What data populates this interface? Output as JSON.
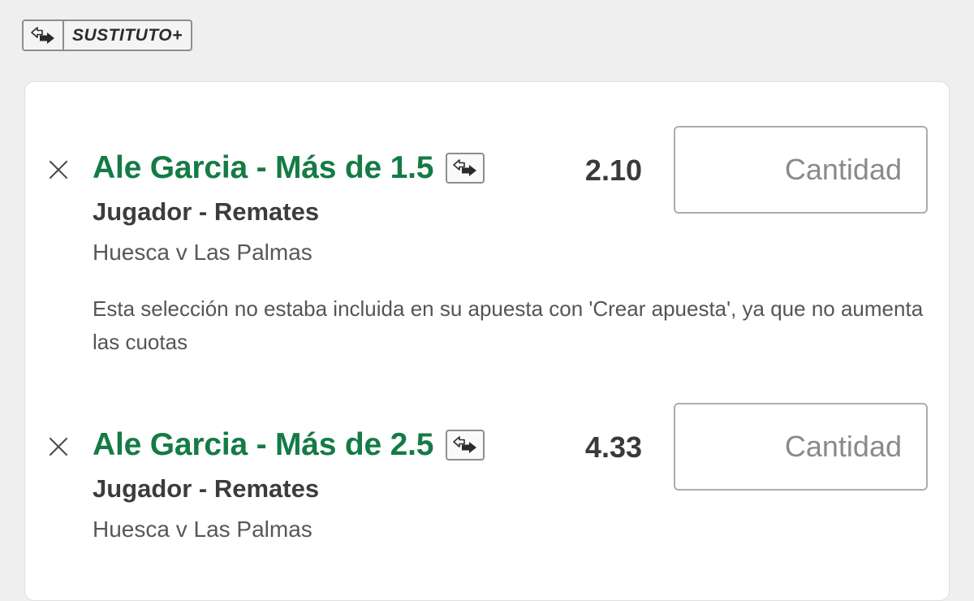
{
  "header": {
    "badge_label": "SUSTITUTO+",
    "badge_icon": "swap-arrows-icon"
  },
  "selections": [
    {
      "title": "Ale Garcia - Más de 1.5",
      "odds": "2.10",
      "market": "Jugador - Remates",
      "event": "Huesca v Las Palmas",
      "stake_placeholder": "Cantidad",
      "notice": "Esta selección no estaba incluida en su apuesta con 'Crear apuesta', ya que no aumenta las cuotas"
    },
    {
      "title": "Ale Garcia - Más de 2.5",
      "odds": "4.33",
      "market": "Jugador - Remates",
      "event": "Huesca v Las Palmas",
      "stake_placeholder": "Cantidad"
    }
  ],
  "colors": {
    "selection_title": "#147b45",
    "background": "#efefef"
  }
}
